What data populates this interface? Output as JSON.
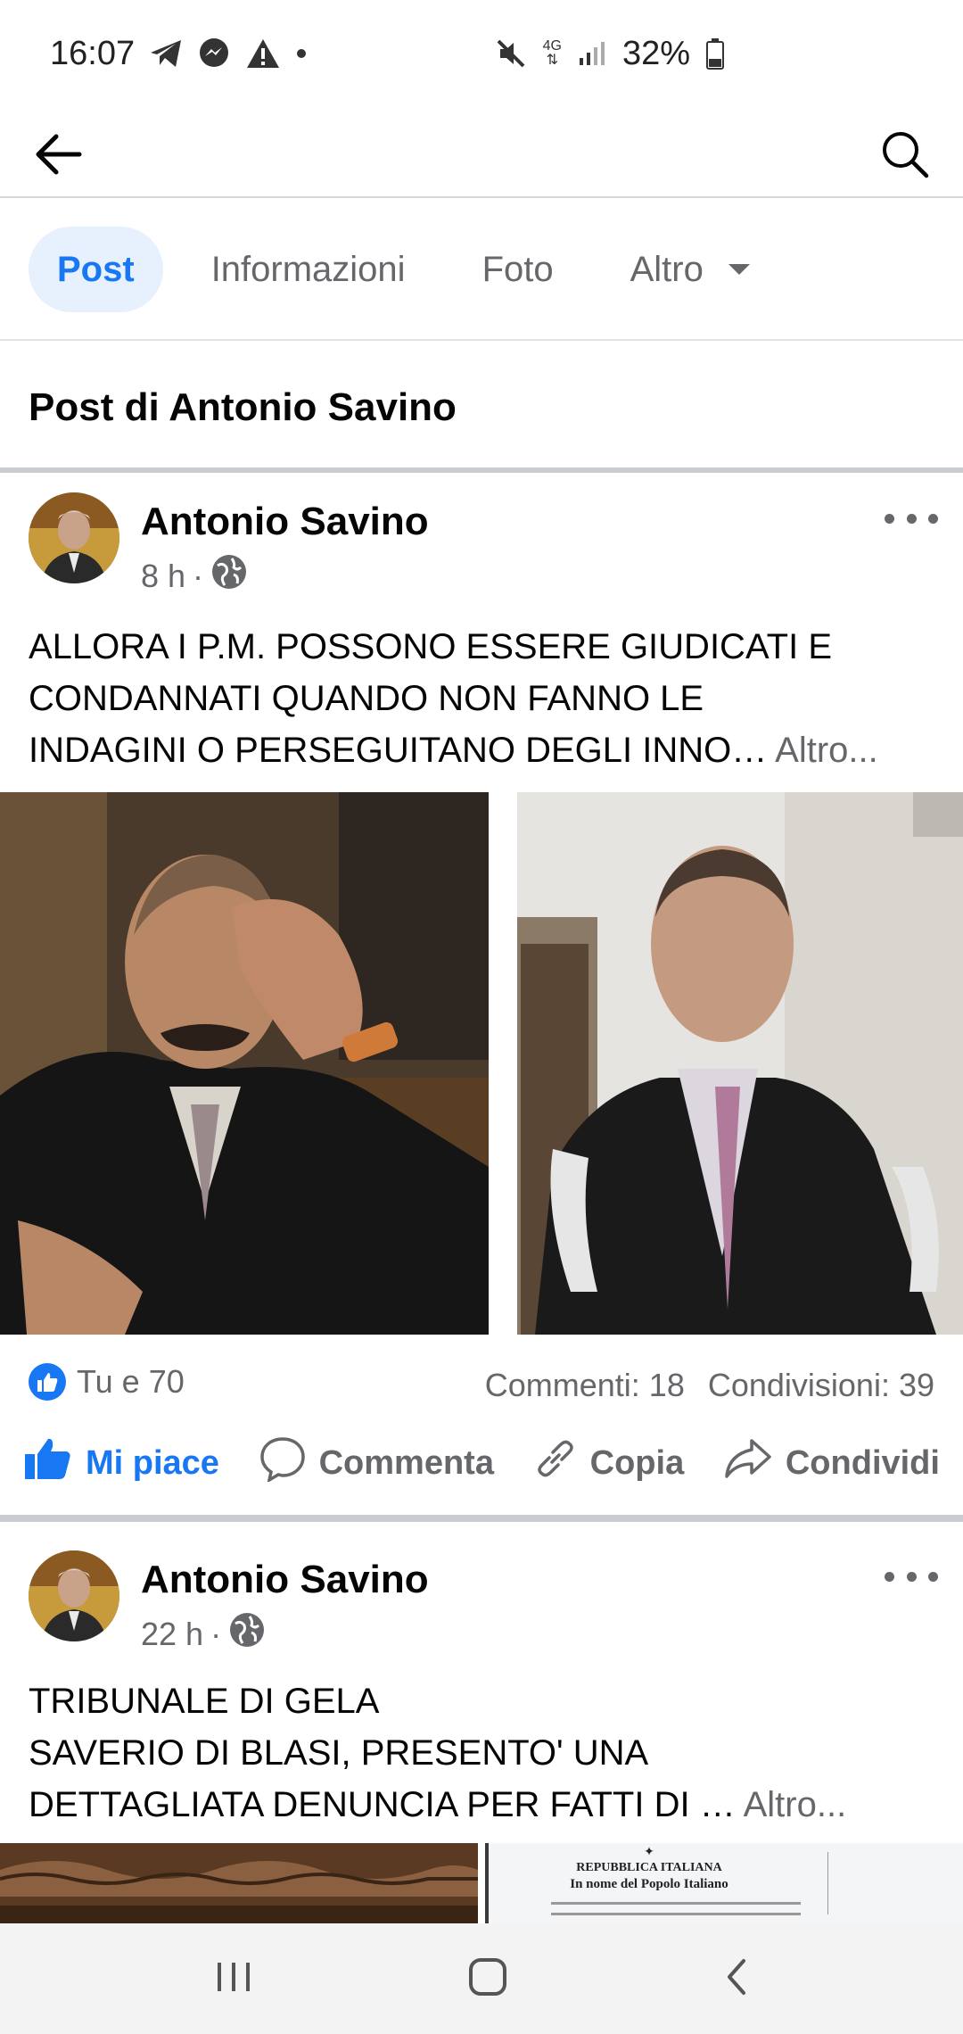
{
  "status_bar": {
    "time": "16:07",
    "network": "4G",
    "battery": "32%"
  },
  "tabs": [
    {
      "label": "Post"
    },
    {
      "label": "Informazioni"
    },
    {
      "label": "Foto"
    },
    {
      "label": "Altro"
    }
  ],
  "section_title": "Post di Antonio Savino",
  "posts": [
    {
      "author": "Antonio Savino",
      "time": "8 h",
      "text_lines": [
        "ALLORA I P.M. POSSONO ESSERE GIUDICATI E",
        "CONDANNATI QUANDO NON FANNO LE",
        "INDAGINI O PERSEGUITANO DEGLI INNO…"
      ],
      "more_link": "Altro...",
      "reactions": "Tu e 70",
      "comments": "Commenti: 18",
      "shares": "Condivisioni: 39"
    },
    {
      "author": "Antonio Savino",
      "time": "22 h",
      "text_lines": [
        "TRIBUNALE DI GELA",
        "SAVERIO DI BLASI, PRESENTO' UNA",
        "DETTAGLIATA DENUNCIA PER FATTI DI …"
      ],
      "more_link": "Altro..."
    }
  ],
  "actions": {
    "like": "Mi piace",
    "comment": "Commenta",
    "copy": "Copia",
    "share": "Condividi"
  },
  "document_preview": {
    "line1": "REPUBBLICA ITALIANA",
    "line2": "In nome del Popolo Italiano"
  },
  "colors": {
    "accent": "#1877f2",
    "secondary_text": "#65676b"
  }
}
